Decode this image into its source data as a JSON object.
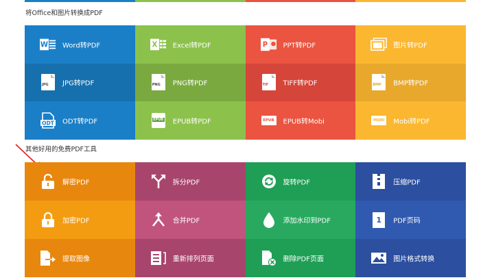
{
  "colors": {
    "blue": "#1a7fc7",
    "green": "#8cc14c",
    "red": "#ea5440",
    "yellow": "#fbb730",
    "blue_dark": "#1670ad",
    "green_dark": "#7aaa3f",
    "red_dark": "#d6453a",
    "yellow_dark": "#e8a82c",
    "orange": "#f39c12",
    "orange_dark": "#e8870e",
    "magenta": "#a8456d",
    "magenta2": "#c0547d",
    "teal": "#1f9e55",
    "teal2": "#28a95f",
    "navy": "#2c4f9f",
    "navy2": "#3059b0",
    "title": "#333333"
  },
  "section_office": {
    "title": "将Office和图片转换成PDF",
    "tiles": [
      {
        "label": "Word转PDF",
        "icon": "word-icon"
      },
      {
        "label": "Excel转PDF",
        "icon": "excel-icon"
      },
      {
        "label": "PPT转PDF",
        "icon": "ppt-icon"
      },
      {
        "label": "图片转PDF",
        "icon": "image-stack-icon"
      },
      {
        "label": "JPG转PDF",
        "icon": "jpg-file-icon",
        "tag": "JPG"
      },
      {
        "label": "PNG转PDF",
        "icon": "png-file-icon",
        "tag": "PNG"
      },
      {
        "label": "TIFF转PDF",
        "icon": "tiff-file-icon",
        "tag": "TIF"
      },
      {
        "label": "BMP转PDF",
        "icon": "bmp-file-icon",
        "tag": "BMP"
      },
      {
        "label": "ODT转PDF",
        "icon": "odt-file-icon",
        "tag": "ODT"
      },
      {
        "label": "EPUB转PDF",
        "icon": "epub-icon",
        "tag": "EPUB"
      },
      {
        "label": "EPUB转Mobi",
        "icon": "epub-badge-icon",
        "tag": "EPUB"
      },
      {
        "label": "Mobi转PDF",
        "icon": "mobi-badge-icon",
        "tag": "MOBI"
      }
    ]
  },
  "section_tools": {
    "title": "其他好用的免费PDF工具",
    "tiles": [
      {
        "label": "解密PDF",
        "icon": "unlock-icon"
      },
      {
        "label": "拆分PDF",
        "icon": "split-icon"
      },
      {
        "label": "旋转PDF",
        "icon": "rotate-icon"
      },
      {
        "label": "压缩PDF",
        "icon": "compress-icon"
      },
      {
        "label": "加密PDF",
        "icon": "lock-icon"
      },
      {
        "label": "合并PDF",
        "icon": "merge-icon"
      },
      {
        "label": "添加水印到PDF",
        "icon": "water-drop-icon"
      },
      {
        "label": "PDF页码",
        "icon": "page-number-icon",
        "tag": "1"
      },
      {
        "label": "提取图像",
        "icon": "extract-icon"
      },
      {
        "label": "重新排列页面",
        "icon": "reorder-icon"
      },
      {
        "label": "删除PDF页面",
        "icon": "delete-page-icon"
      },
      {
        "label": "图片格式转换",
        "icon": "image-convert-icon"
      }
    ]
  }
}
